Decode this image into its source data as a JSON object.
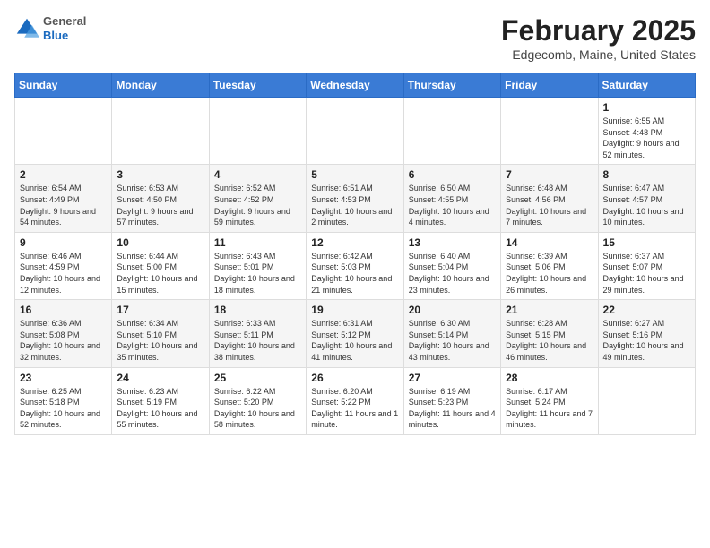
{
  "header": {
    "logo": {
      "general": "General",
      "blue": "Blue"
    },
    "title": "February 2025",
    "subtitle": "Edgecomb, Maine, United States"
  },
  "weekdays": [
    "Sunday",
    "Monday",
    "Tuesday",
    "Wednesday",
    "Thursday",
    "Friday",
    "Saturday"
  ],
  "weeks": [
    [
      {
        "day": "",
        "info": ""
      },
      {
        "day": "",
        "info": ""
      },
      {
        "day": "",
        "info": ""
      },
      {
        "day": "",
        "info": ""
      },
      {
        "day": "",
        "info": ""
      },
      {
        "day": "",
        "info": ""
      },
      {
        "day": "1",
        "info": "Sunrise: 6:55 AM\nSunset: 4:48 PM\nDaylight: 9 hours and 52 minutes."
      }
    ],
    [
      {
        "day": "2",
        "info": "Sunrise: 6:54 AM\nSunset: 4:49 PM\nDaylight: 9 hours and 54 minutes."
      },
      {
        "day": "3",
        "info": "Sunrise: 6:53 AM\nSunset: 4:50 PM\nDaylight: 9 hours and 57 minutes."
      },
      {
        "day": "4",
        "info": "Sunrise: 6:52 AM\nSunset: 4:52 PM\nDaylight: 9 hours and 59 minutes."
      },
      {
        "day": "5",
        "info": "Sunrise: 6:51 AM\nSunset: 4:53 PM\nDaylight: 10 hours and 2 minutes."
      },
      {
        "day": "6",
        "info": "Sunrise: 6:50 AM\nSunset: 4:55 PM\nDaylight: 10 hours and 4 minutes."
      },
      {
        "day": "7",
        "info": "Sunrise: 6:48 AM\nSunset: 4:56 PM\nDaylight: 10 hours and 7 minutes."
      },
      {
        "day": "8",
        "info": "Sunrise: 6:47 AM\nSunset: 4:57 PM\nDaylight: 10 hours and 10 minutes."
      }
    ],
    [
      {
        "day": "9",
        "info": "Sunrise: 6:46 AM\nSunset: 4:59 PM\nDaylight: 10 hours and 12 minutes."
      },
      {
        "day": "10",
        "info": "Sunrise: 6:44 AM\nSunset: 5:00 PM\nDaylight: 10 hours and 15 minutes."
      },
      {
        "day": "11",
        "info": "Sunrise: 6:43 AM\nSunset: 5:01 PM\nDaylight: 10 hours and 18 minutes."
      },
      {
        "day": "12",
        "info": "Sunrise: 6:42 AM\nSunset: 5:03 PM\nDaylight: 10 hours and 21 minutes."
      },
      {
        "day": "13",
        "info": "Sunrise: 6:40 AM\nSunset: 5:04 PM\nDaylight: 10 hours and 23 minutes."
      },
      {
        "day": "14",
        "info": "Sunrise: 6:39 AM\nSunset: 5:06 PM\nDaylight: 10 hours and 26 minutes."
      },
      {
        "day": "15",
        "info": "Sunrise: 6:37 AM\nSunset: 5:07 PM\nDaylight: 10 hours and 29 minutes."
      }
    ],
    [
      {
        "day": "16",
        "info": "Sunrise: 6:36 AM\nSunset: 5:08 PM\nDaylight: 10 hours and 32 minutes."
      },
      {
        "day": "17",
        "info": "Sunrise: 6:34 AM\nSunset: 5:10 PM\nDaylight: 10 hours and 35 minutes."
      },
      {
        "day": "18",
        "info": "Sunrise: 6:33 AM\nSunset: 5:11 PM\nDaylight: 10 hours and 38 minutes."
      },
      {
        "day": "19",
        "info": "Sunrise: 6:31 AM\nSunset: 5:12 PM\nDaylight: 10 hours and 41 minutes."
      },
      {
        "day": "20",
        "info": "Sunrise: 6:30 AM\nSunset: 5:14 PM\nDaylight: 10 hours and 43 minutes."
      },
      {
        "day": "21",
        "info": "Sunrise: 6:28 AM\nSunset: 5:15 PM\nDaylight: 10 hours and 46 minutes."
      },
      {
        "day": "22",
        "info": "Sunrise: 6:27 AM\nSunset: 5:16 PM\nDaylight: 10 hours and 49 minutes."
      }
    ],
    [
      {
        "day": "23",
        "info": "Sunrise: 6:25 AM\nSunset: 5:18 PM\nDaylight: 10 hours and 52 minutes."
      },
      {
        "day": "24",
        "info": "Sunrise: 6:23 AM\nSunset: 5:19 PM\nDaylight: 10 hours and 55 minutes."
      },
      {
        "day": "25",
        "info": "Sunrise: 6:22 AM\nSunset: 5:20 PM\nDaylight: 10 hours and 58 minutes."
      },
      {
        "day": "26",
        "info": "Sunrise: 6:20 AM\nSunset: 5:22 PM\nDaylight: 11 hours and 1 minute."
      },
      {
        "day": "27",
        "info": "Sunrise: 6:19 AM\nSunset: 5:23 PM\nDaylight: 11 hours and 4 minutes."
      },
      {
        "day": "28",
        "info": "Sunrise: 6:17 AM\nSunset: 5:24 PM\nDaylight: 11 hours and 7 minutes."
      },
      {
        "day": "",
        "info": ""
      }
    ]
  ]
}
